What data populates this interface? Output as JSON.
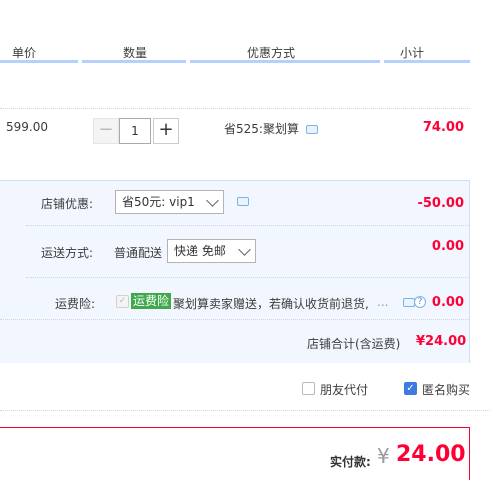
{
  "header": {
    "unit_price": "单价",
    "quantity": "数量",
    "discount_method": "优惠方式",
    "subtotal": "小计"
  },
  "item": {
    "price": "599.00",
    "quantity": "1",
    "minus": "−",
    "plus": "+",
    "promo": "省525:聚划算",
    "subtotal": "74.00"
  },
  "shop_discount": {
    "label": "店铺优惠:",
    "selected": "省50元: vip1",
    "value": "-50.00"
  },
  "shipping": {
    "label": "运送方式:",
    "method": "普通配送",
    "selected": "快递 免邮",
    "value": "0.00"
  },
  "insurance": {
    "label": "运费险:",
    "tag": "运费险",
    "description": "聚划算卖家赠送，若确认收货前退货,",
    "ellipsis": "...",
    "help": "?",
    "value": "0.00"
  },
  "shop_total": {
    "label": "店铺合计(含运费)",
    "value": "¥24.00"
  },
  "options": {
    "friend_pay": "朋友代付",
    "friend_pay_checked": false,
    "anonymous": "匿名购买",
    "anonymous_checked": true
  },
  "payment": {
    "label": "实付款:",
    "currency": "¥",
    "amount": "24.00"
  },
  "colors": {
    "accent_red": "#ff0036",
    "header_line": "#b2d1ff",
    "panel_bg": "#f2f7ff",
    "tag_green": "#3fa84a",
    "check_blue": "#3c7be0"
  },
  "icons": [
    "chat-bubble-icon",
    "chevron-down-icon",
    "help-circle-icon",
    "check-icon"
  ]
}
